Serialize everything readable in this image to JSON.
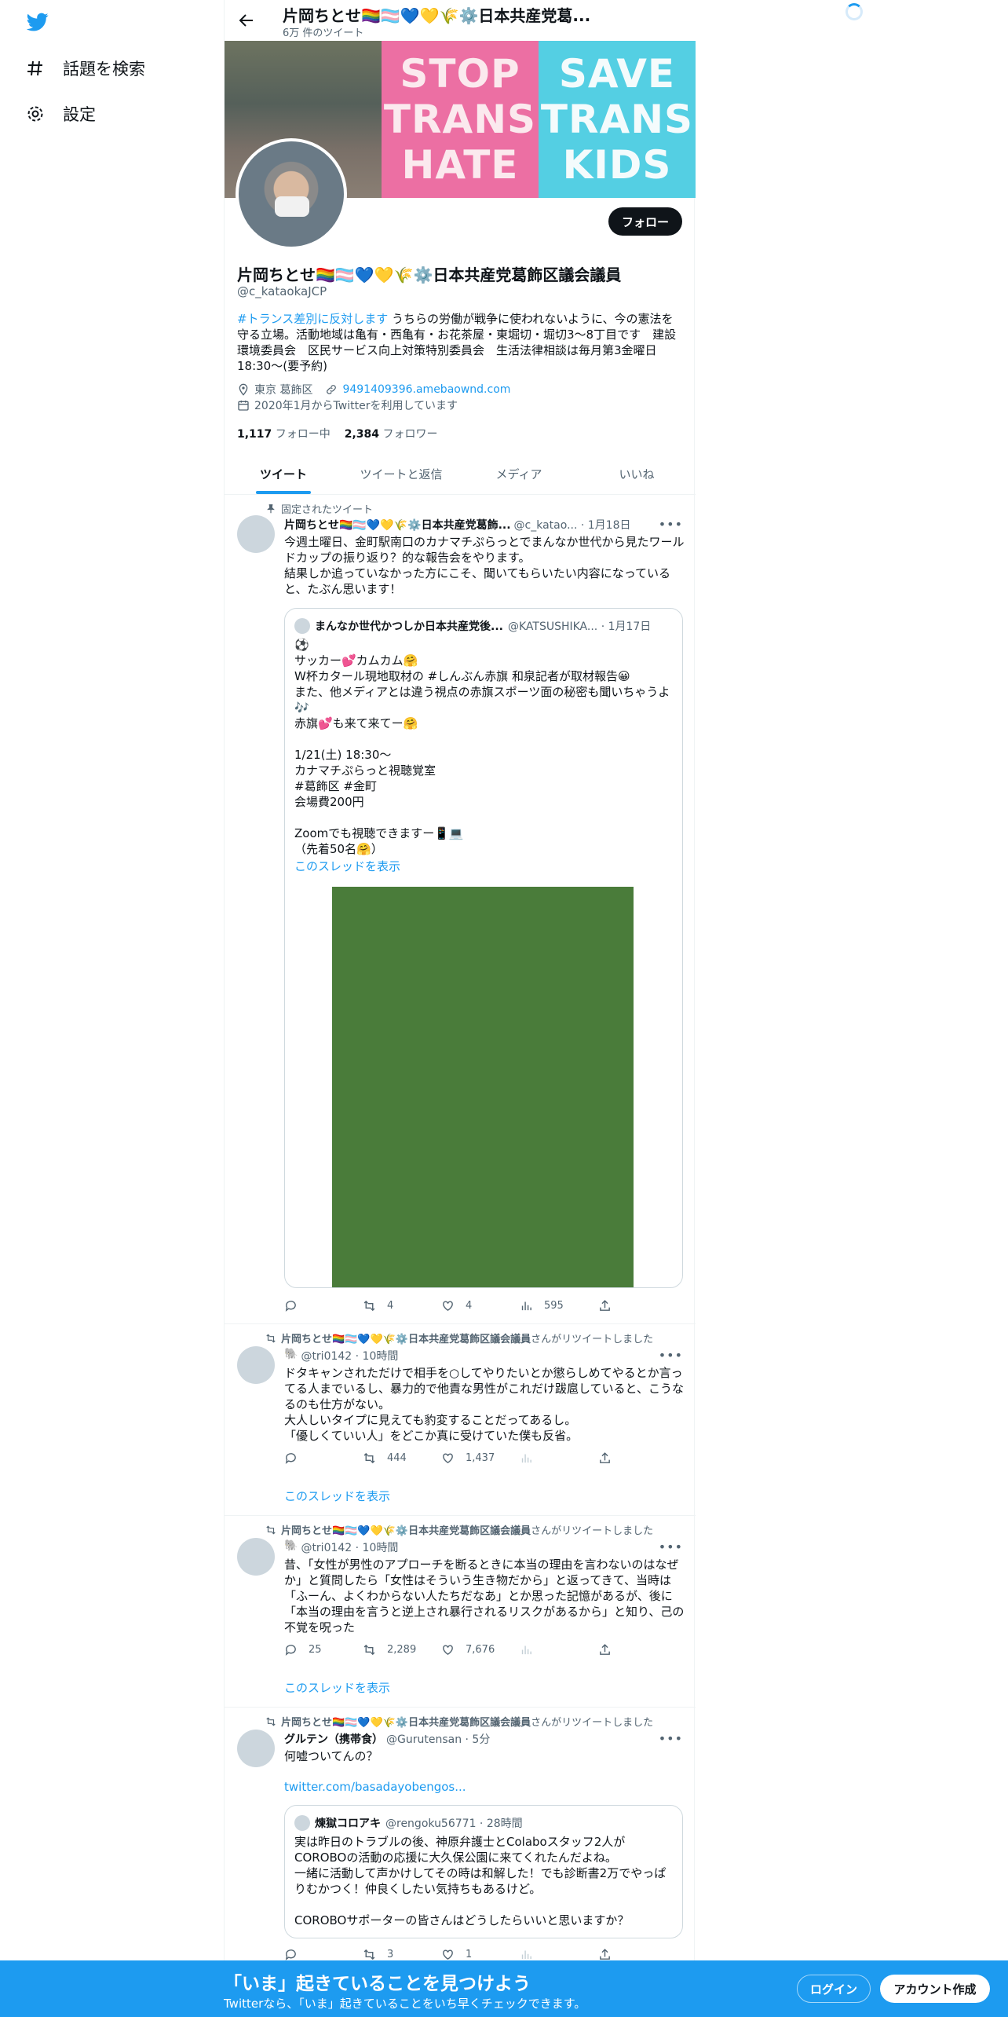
{
  "nav": {
    "explore_label": "話題を検索",
    "settings_label": "設定"
  },
  "header": {
    "name": "片岡ちとせ🏳️‍🌈🏳️‍⚧️💙💛🌾⚙️日本共産党葛...",
    "tweet_count": "6万 件のツイート"
  },
  "banner": {
    "pink_words": [
      "STOP",
      "TRANS",
      "HATE"
    ],
    "cyan_words": [
      "SAVE",
      "TRANS",
      "KIDS"
    ]
  },
  "profile": {
    "follow_label": "フォロー",
    "name": "片岡ちとせ🏳️‍🌈🏳️‍⚧️💙💛🌾⚙️日本共産党葛飾区議会議員",
    "handle": "@c_kataokaJCP",
    "bio_hashtag": "#トランス差別に反対します",
    "bio_text": " うちらの労働が戦争に使われないように、今の憲法を守る立場。活動地域は亀有・西亀有・お花茶屋・東堀切・堀切3～8丁目です　建設環境委員会　区民サービス向上対策特別委員会　生活法律相談は毎月第3金曜日18:30～(要予約)",
    "location": "東京 葛飾区",
    "website": "9491409396.amebaownd.com",
    "joined": "2020年1月からTwitterを利用しています",
    "following_count": "1,117",
    "following_label": "フォロー中",
    "followers_count": "2,384",
    "followers_label": "フォロワー"
  },
  "tabs": [
    {
      "label": "ツイート"
    },
    {
      "label": "ツイートと返信"
    },
    {
      "label": "メディア"
    },
    {
      "label": "いいね"
    }
  ],
  "tweets": [
    {
      "context": "固定されたツイート",
      "name": "片岡ちとせ🏳️‍🌈🏳️‍⚧️💙💛🌾⚙️日本共産党葛飾...",
      "meta": "@c_katao... · 1月18日",
      "body": "今週土曜日、金町駅南口のカナマチぷらっとでまんなか世代から見たワールドカップの振り返り？的な報告会をやります。\n結果しか追っていなかった方にこそ、聞いてもらいたい内容になっていると、たぶん思います！",
      "quote": {
        "name": "まんなか世代かつしか日本共産党後...",
        "meta": "@KATSUSHIKA... · 1月17日",
        "body": "⚽\nサッカー💕カムカム🤗\nW杯カタール現地取材の #しんぶん赤旗 和泉記者が取材報告😀\nまた、他メディアとは違う視点の赤旗スポーツ面の秘密も聞いちゃうよ🎶\n赤旗💕も来て来てー🤗\n\n1/21(土) 18:30～\nカナマチぷらっと視聴覚室\n#葛飾区 #金町\n会場費200円\n\nZoomでも視聴できますー📱💻\n（先着50名🤗）",
        "thread_label": "このスレッドを表示"
      },
      "replies": "",
      "retweets": "4",
      "likes": "4",
      "views": "595"
    },
    {
      "context_name": "片岡ちとせ🏳️‍🌈🏳️‍⚧️💙💛🌾⚙️日本共産党葛飾区議会議員",
      "context_suffix": "さんがリツイートしました",
      "name": "🐘",
      "meta": "@tri0142 · 10時間",
      "body": "ドタキャンされただけで相手を○してやりたいとか懲らしめてやるとか言ってる人までいるし、暴力的で他責な男性がこれだけ跋扈していると、こうなるのも仕方がない。\n大人しいタイプに見えても豹変することだってあるし。\n「優しくていい人」をどこか真に受けていた僕も反省。",
      "replies": "",
      "retweets": "444",
      "likes": "1,437",
      "views": "",
      "thread_label": "このスレッドを表示"
    },
    {
      "context_name": "片岡ちとせ🏳️‍🌈🏳️‍⚧️💙💛🌾⚙️日本共産党葛飾区議会議員",
      "context_suffix": "さんがリツイートしました",
      "name": "🐘",
      "meta": "@tri0142 · 10時間",
      "body": "昔、「女性が男性のアプローチを断るときに本当の理由を言わないのはなぜか」と質問したら「女性はそういう生き物だから」と返ってきて、当時は「ふーん、よくわからない人たちだなあ」とか思った記憶があるが、後に「本当の理由を言うと逆上され暴行されるリスクがあるから」と知り、己の不覚を呪った",
      "replies": "25",
      "retweets": "2,289",
      "likes": "7,676",
      "views": "",
      "thread_label": "このスレッドを表示"
    },
    {
      "context_name": "片岡ちとせ🏳️‍🌈🏳️‍⚧️💙💛🌾⚙️日本共産党葛飾区議会議員",
      "context_suffix": "さんがリツイートしました",
      "name": "グルテン（携帯食）",
      "meta": "@Gurutensan · 5分",
      "body": "何嘘ついてんの？",
      "link": "twitter.com/basadayobengos...",
      "quote": {
        "name": "煉獄コロアキ",
        "meta": "@rengoku56771 · 28時間",
        "body": "実は昨日のトラブルの後、神原弁護士とColaboスタッフ2人がCOROBOの活動の応援に大久保公園に来てくれたんだよね。\n一緒に活動して声かけしてその時は和解した！でも診断書2万でやっぱりむかつく！仲良くしたい気持ちもあるけど。\n\nCOROBOサポーターの皆さんはどうしたらいいと思いますか？"
      },
      "replies": "",
      "retweets": "3",
      "likes": "1",
      "views": ""
    }
  ],
  "bottom": {
    "title": "「いま」起きていることを見つけよう",
    "subtitle": "Twitterなら、「いま」起きていることをいち早くチェックできます。",
    "login_label": "ログイン",
    "signup_label": "アカウント作成"
  }
}
